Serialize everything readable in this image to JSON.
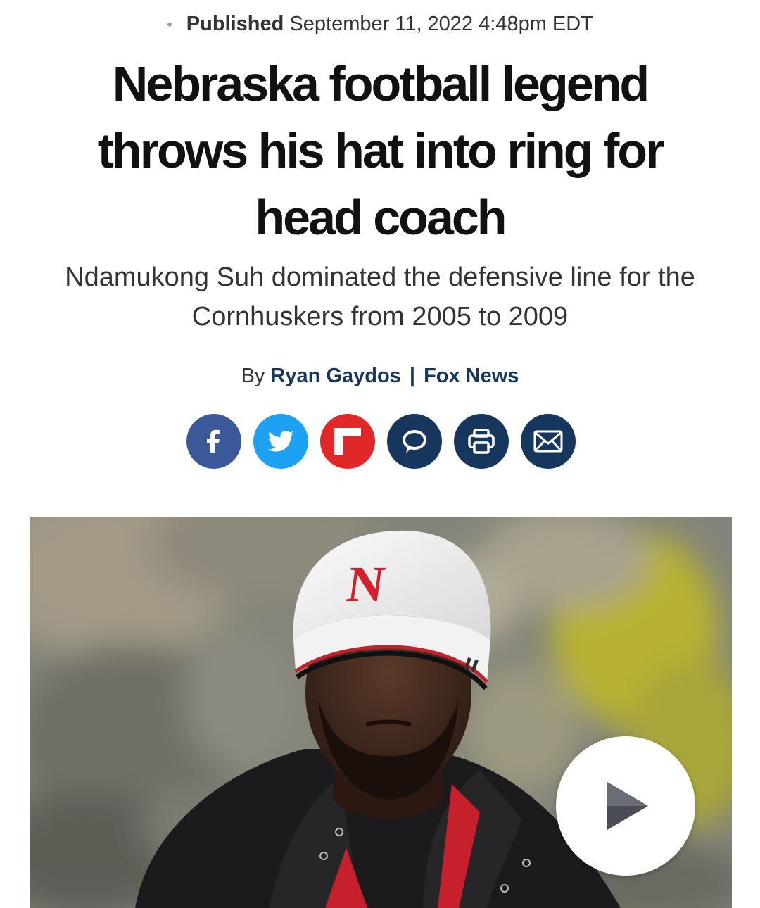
{
  "meta": {
    "published_label": "Published",
    "published_date": "September 11, 2022 4:48pm EDT"
  },
  "article": {
    "headline": "Nebraska football legend throws his hat into ring for head coach",
    "dek": "Ndamukong Suh dominated the defensive line for the Cornhuskers from 2005 to 2009",
    "byline_prefix": "By",
    "author": "Ryan Gaydos",
    "byline_separator": "|",
    "source": "Fox News"
  },
  "share": {
    "buttons": [
      {
        "name": "facebook",
        "icon": "facebook-icon",
        "color": "#3b5998"
      },
      {
        "name": "twitter",
        "icon": "twitter-icon",
        "color": "#1da1f2"
      },
      {
        "name": "flipboard",
        "icon": "flipboard-icon",
        "color": "#e12828"
      },
      {
        "name": "comments",
        "icon": "comment-icon",
        "color": "#17365e"
      },
      {
        "name": "print",
        "icon": "print-icon",
        "color": "#17365e"
      },
      {
        "name": "email",
        "icon": "email-icon",
        "color": "#17365e"
      }
    ]
  },
  "hero": {
    "hat_letter": "N",
    "play_icon": "play-icon"
  }
}
